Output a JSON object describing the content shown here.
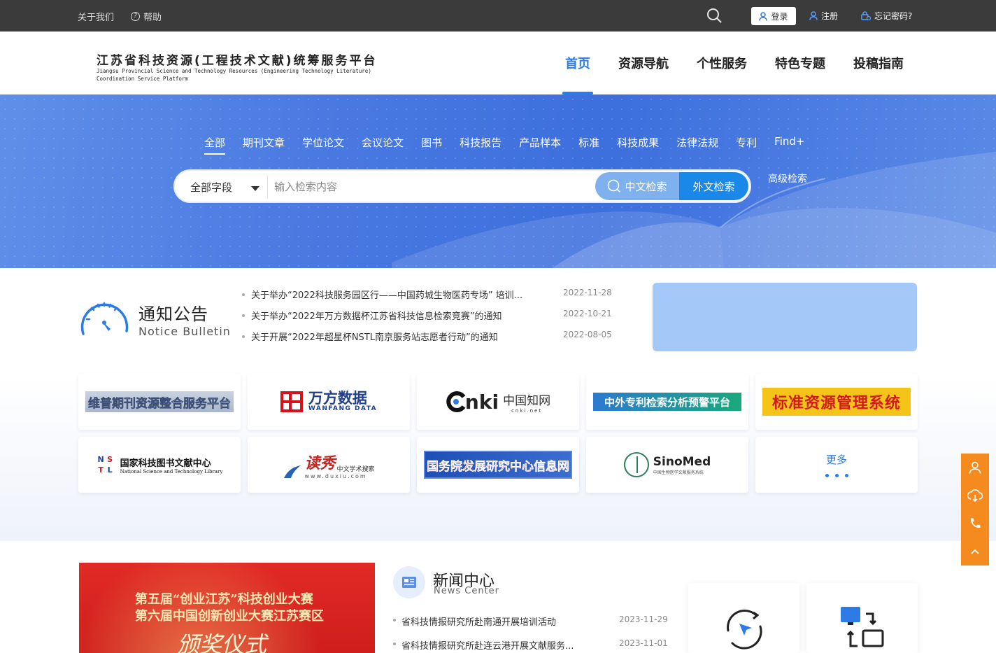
{
  "topbar": {
    "about": "关于我们",
    "help": "帮助",
    "login": "登录",
    "register": "注册",
    "forgot": "忘记密码?"
  },
  "header": {
    "logo_cn": "江苏省科技资源(工程技术文献)统筹服务平台",
    "logo_en": "Jiangsu Provincial Science and Technology Resources (Engineering Technology Literature) Coordination Service Platform",
    "nav": [
      "首页",
      "资源导航",
      "个性服务",
      "特色专题",
      "投稿指南"
    ]
  },
  "search": {
    "tabs": [
      "全部",
      "期刊文章",
      "学位论文",
      "会议论文",
      "图书",
      "科技报告",
      "产品样本",
      "标准",
      "科技成果",
      "法律法规",
      "专利",
      "Find+"
    ],
    "field": "全部字段",
    "placeholder": "输入检索内容",
    "btn_cn": "中文检索",
    "btn_en": "外文检索",
    "advanced": "高级检索"
  },
  "notice": {
    "title_cn": "通知公告",
    "title_en": "Notice Bulletin",
    "items": [
      {
        "title": "关于举办“2022科技服务园区行——中国药城生物医药专场” 培训...",
        "date": "2022-11-28"
      },
      {
        "title": "关于举办“2022年万方数据杯江苏省科技信息检索竞赛”的通知",
        "date": "2022-10-21"
      },
      {
        "title": "关于开展“2022年超星杯NSTL南京服务站志愿者行动”的通知",
        "date": "2022-08-05"
      }
    ]
  },
  "resources": {
    "weipu": "维普期刊资源整合服务平台",
    "wanfang": "万方数据",
    "wanfang_en": "WANFANG DATA",
    "cnki": "nki",
    "cnki_cn": "中国知网",
    "cnki_url": "cnki.net",
    "patent": "中外专利检索分析预警平台",
    "standard": "标准资源管理系统",
    "nstl_cn": "国家科技图书文献中心",
    "nstl_en": "National Science and Technology Library",
    "duxiu": "读秀",
    "duxiu_sub": "中文学术搜索",
    "duxiu_url": "www.duxiu.com",
    "drc": "国务院发展研究中心信息网",
    "sinomed": "SinoMed",
    "sinomed_sub": "中国生物医学文献服务系统",
    "more": "更多"
  },
  "news": {
    "img_line1": "第五届“创业江苏”科技创业大赛",
    "img_line2": "第六届中国创新创业大赛江苏赛区",
    "img_line3": "颁奖仪式",
    "title_cn": "新闻中心",
    "title_en": "News Center",
    "items": [
      {
        "title": "省科技情报研究所赴南通开展培训活动",
        "date": "2023-11-29"
      },
      {
        "title": "省科技情报研究所赴连云港开展文献服务...",
        "date": "2023-11-01"
      }
    ]
  },
  "colors": {
    "accent": "#2d7be5",
    "float": "#f58a1f",
    "topbar": "#3b3b3b"
  }
}
